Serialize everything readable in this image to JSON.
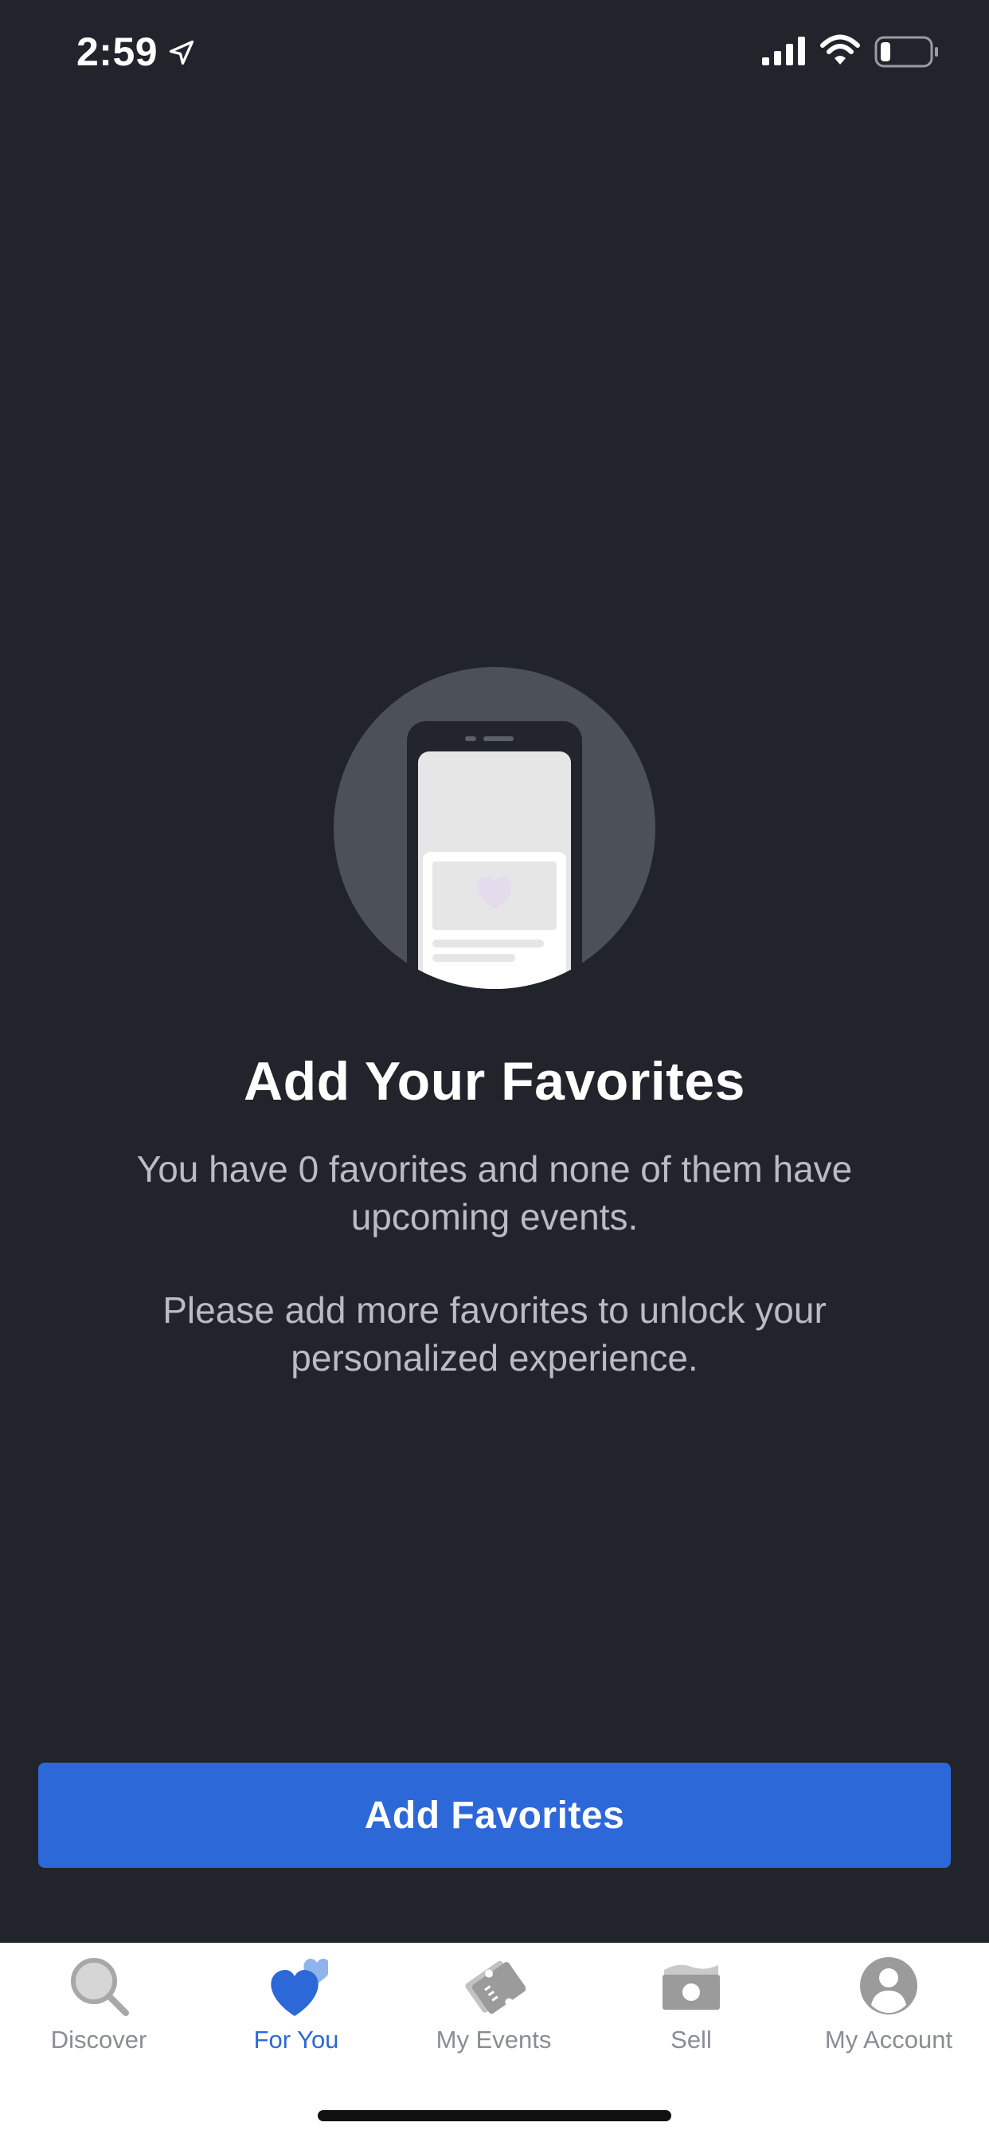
{
  "status_bar": {
    "time": "2:59",
    "icons": [
      "location-arrow-icon",
      "cellular-signal-icon",
      "wifi-icon",
      "battery-icon"
    ]
  },
  "empty_state": {
    "illustration": "phone-heart-illustration",
    "title": "Add Your Favorites",
    "message": "You have 0 favorites and none of them have upcoming events.",
    "submessage": "Please add more favorites to unlock your personalized experience."
  },
  "cta": {
    "label": "Add Favorites"
  },
  "tabs": [
    {
      "label": "Discover",
      "icon": "search-icon",
      "active": false
    },
    {
      "label": "For You",
      "icon": "heart-icon",
      "active": true
    },
    {
      "label": "My Events",
      "icon": "tickets-icon",
      "active": false
    },
    {
      "label": "Sell",
      "icon": "cash-icon",
      "active": false
    },
    {
      "label": "My Account",
      "icon": "account-icon",
      "active": false
    }
  ],
  "colors": {
    "background": "#21242b",
    "accent": "#2d68d8",
    "tab_bar": "#ffffff",
    "inactive_tab": "#8a8d93"
  }
}
